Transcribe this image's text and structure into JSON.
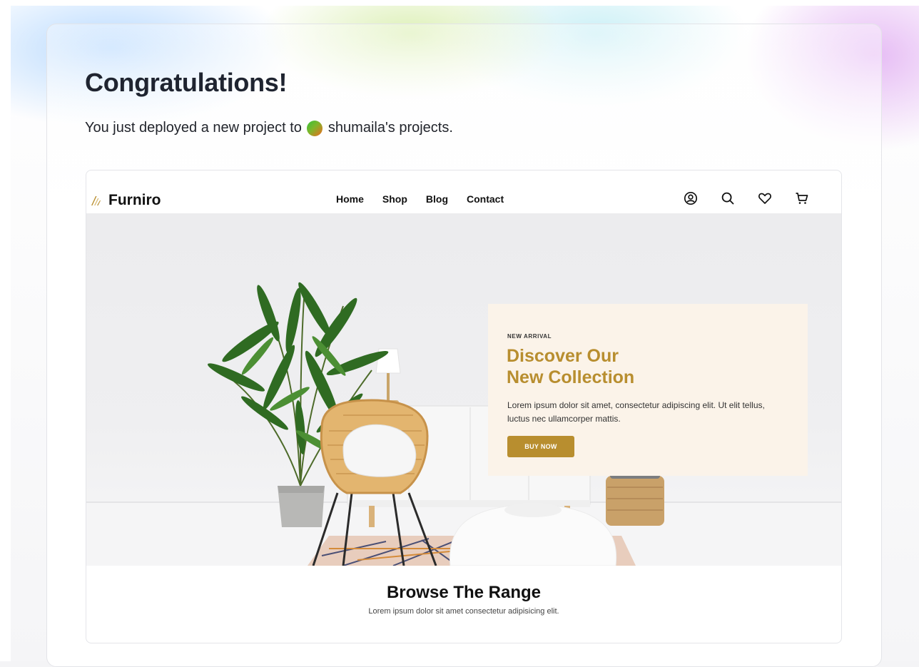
{
  "deployment": {
    "title": "Congratulations!",
    "subtitle_prefix": "You just deployed a new project to",
    "team_name": "shumaila's projects."
  },
  "preview_site": {
    "brand": "Furniro",
    "nav": [
      "Home",
      "Shop",
      "Blog",
      "Contact"
    ],
    "header_icons": [
      "account-icon",
      "search-icon",
      "heart-icon",
      "cart-icon"
    ],
    "hero": {
      "eyebrow": "NEW ARRIVAL",
      "heading_line1": "Discover Our",
      "heading_line2": "New Collection",
      "body": "Lorem ipsum dolor sit amet, consectetur adipiscing elit. Ut elit tellus, luctus nec ullamcorper mattis.",
      "button": "BUY NOW"
    },
    "browse": {
      "title": "Browse The Range",
      "subtitle": "Lorem ipsum dolor sit amet consectetur adipisicing elit."
    }
  },
  "colors": {
    "accent": "#b88e2f",
    "hero_box": "#fbf3e9",
    "text_dark": "#1f2430"
  }
}
